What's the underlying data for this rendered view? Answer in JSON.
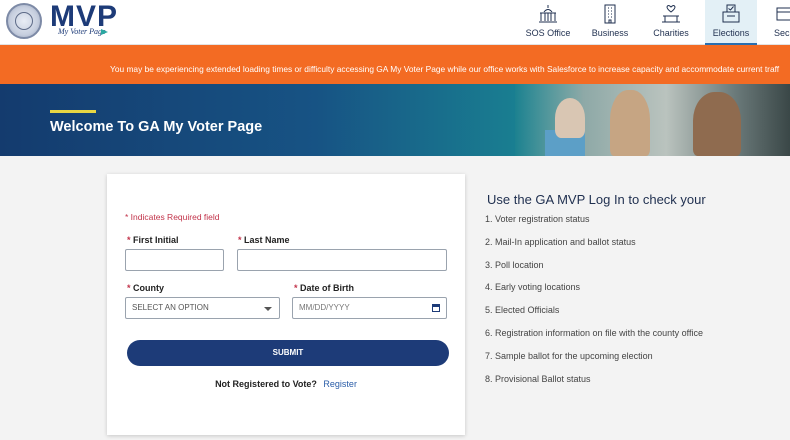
{
  "header": {
    "logo_text": "MVP",
    "logo_subtext": "My Voter Page",
    "nav": [
      {
        "label": "SOS Office",
        "icon": "capitol-building-icon"
      },
      {
        "label": "Business",
        "icon": "office-building-icon"
      },
      {
        "label": "Charities",
        "icon": "charity-hands-icon"
      },
      {
        "label": "Elections",
        "icon": "ballot-box-icon",
        "active": true
      },
      {
        "label": "Secu",
        "icon": "securities-icon"
      }
    ]
  },
  "alert": {
    "text": "You may be experiencing extended loading times or difficulty accessing GA My Voter Page while our office works with Salesforce to increase capacity and accommodate current traff"
  },
  "hero": {
    "title": "Welcome To GA My Voter Page"
  },
  "form": {
    "required_note": "* Indicates Required field",
    "first_initial_label": "First Initial",
    "last_name_label": "Last Name",
    "county_label": "County",
    "county_value": "SELECT AN OPTION",
    "dob_label": "Date of Birth",
    "dob_placeholder": "MM/DD/YYYY",
    "submit_label": "SUBMIT",
    "not_registered_text": "Not Registered to Vote?",
    "register_link": "Register"
  },
  "info": {
    "title": "Use the GA MVP Log In to check your",
    "items": [
      "1. Voter registration status",
      "2. Mail-In application and ballot status",
      "3. Poll location",
      "4. Early voting locations",
      "5. Elected Officials",
      "6. Registration information on file with the county office",
      "7. Sample ballot for the upcoming election",
      "8. Provisional Ballot status"
    ]
  },
  "colors": {
    "brand_navy": "#1d3b78",
    "alert_orange": "#f36b23",
    "required_red": "#c2334a",
    "accent_yellow": "#e8d643"
  }
}
